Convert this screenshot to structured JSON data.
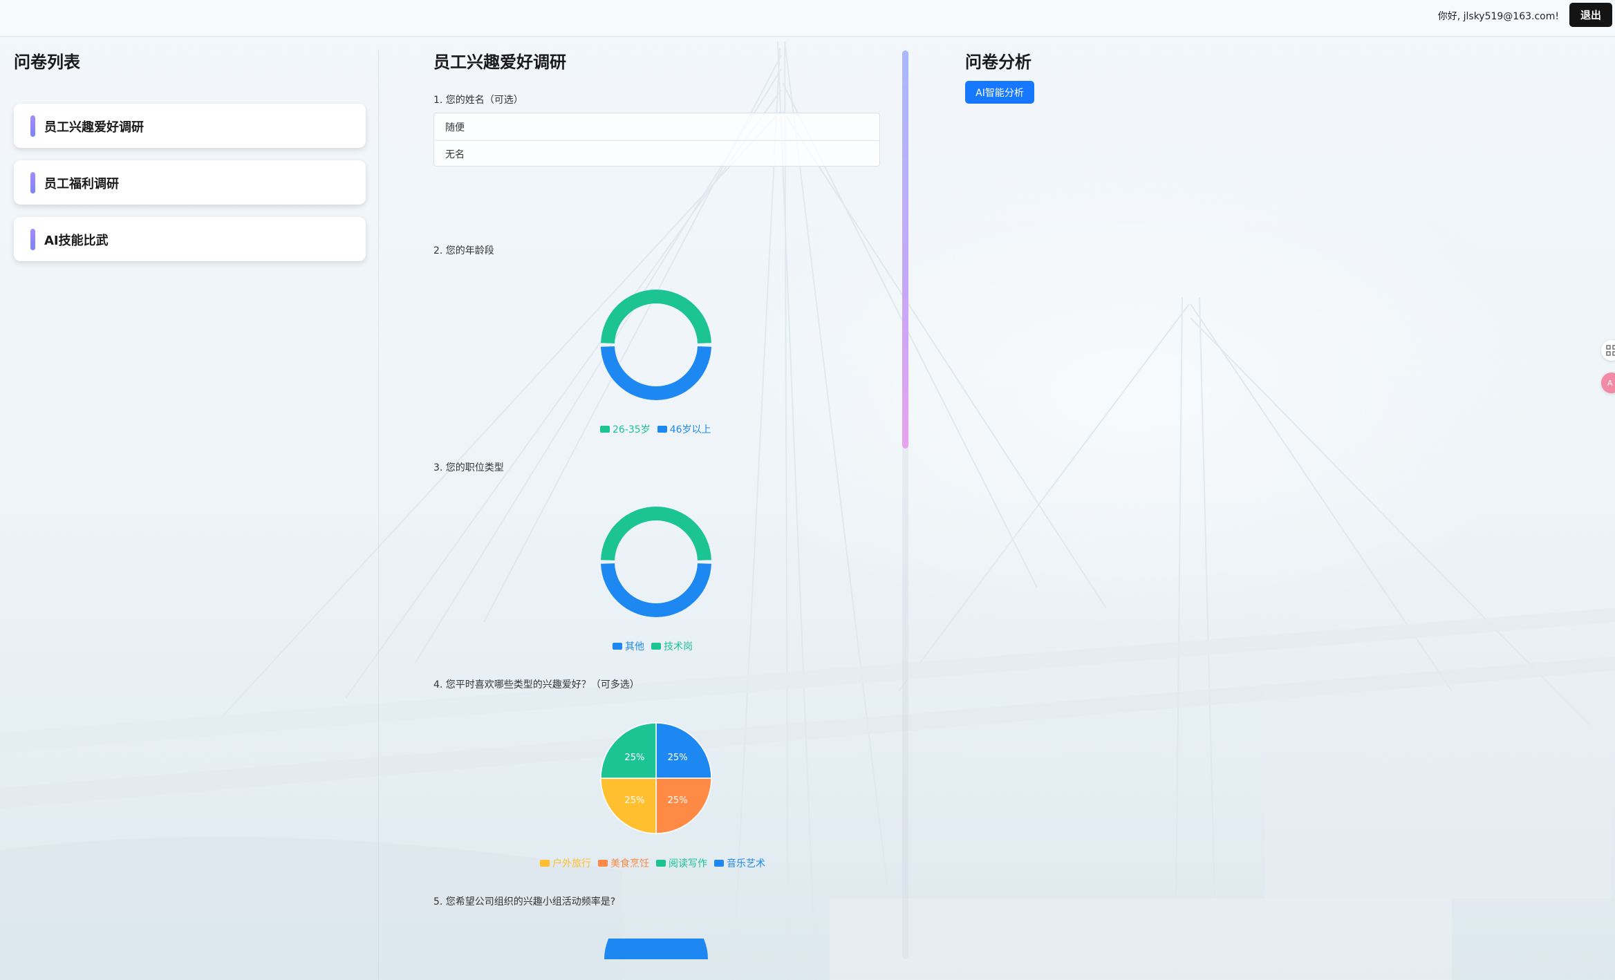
{
  "header": {
    "greeting": "你好, jlsky519@163.com!",
    "logout_label": "退出"
  },
  "sidebar": {
    "title": "问卷列表",
    "items": [
      {
        "label": "员工兴趣爱好调研"
      },
      {
        "label": "员工福利调研"
      },
      {
        "label": "AI技能比武"
      }
    ]
  },
  "main": {
    "title": "员工兴趣爱好调研",
    "questions": [
      {
        "label": "1. 您的姓名（可选）",
        "answers": [
          "随便",
          "无名"
        ]
      },
      {
        "label": "2. 您的年龄段"
      },
      {
        "label": "3. 您的职位类型"
      },
      {
        "label": "4. 您平时喜欢哪些类型的兴趣爱好？（可多选）"
      },
      {
        "label": "5. 您希望公司组织的兴趣小组活动频率是?"
      }
    ]
  },
  "analysis": {
    "title": "问卷分析",
    "ai_button_label": "AI智能分析"
  },
  "colors": {
    "blue": "#1e88f2",
    "green": "#1cc393",
    "orange": "#ff8a45",
    "yellow": "#ffbf2e",
    "primary_button": "#1677ff",
    "logout_button": "#141414"
  },
  "chart_data": [
    {
      "type": "pie",
      "style": "donut",
      "legend": [
        "26-35岁",
        "46岁以上"
      ],
      "series": [
        {
          "label": "26-35岁",
          "value": 50,
          "color": "#1cc393"
        },
        {
          "label": "46岁以上",
          "value": 50,
          "color": "#1e88f2"
        }
      ]
    },
    {
      "type": "pie",
      "style": "donut",
      "legend": [
        "其他",
        "技术岗"
      ],
      "series": [
        {
          "label": "其他",
          "value": 50,
          "color": "#1e88f2"
        },
        {
          "label": "技术岗",
          "value": 50,
          "color": "#1cc393"
        }
      ]
    },
    {
      "type": "pie",
      "style": "pie",
      "legend": [
        "户外旅行",
        "美食烹饪",
        "阅读写作",
        "音乐艺术"
      ],
      "series": [
        {
          "label": "音乐艺术",
          "value": 25,
          "color": "#1e88f2",
          "data_label": "25%"
        },
        {
          "label": "美食烹饪",
          "value": 25,
          "color": "#ff8a45",
          "data_label": "25%"
        },
        {
          "label": "户外旅行",
          "value": 25,
          "color": "#ffbf2e",
          "data_label": "25%"
        },
        {
          "label": "阅读写作",
          "value": 25,
          "color": "#1cc393",
          "data_label": "25%"
        }
      ]
    }
  ],
  "icons": {
    "float_top": "grid-icon",
    "float_bottom": "translate-icon"
  }
}
